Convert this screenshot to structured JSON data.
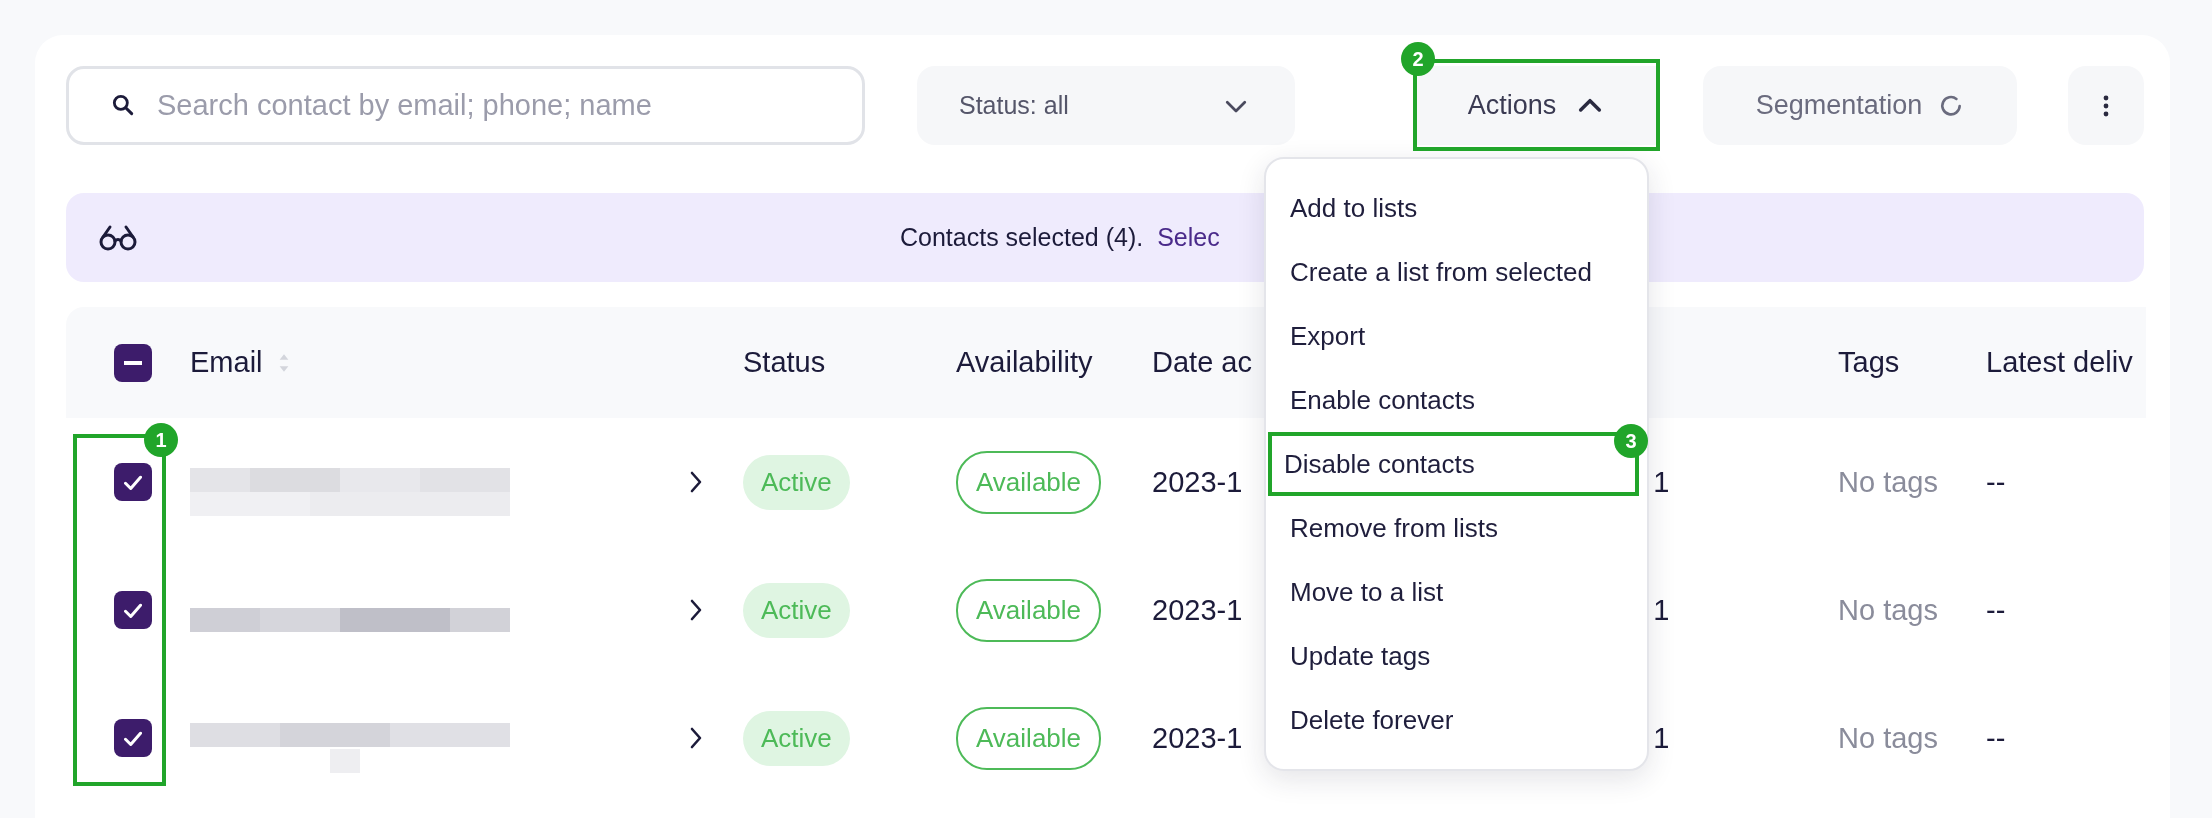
{
  "search": {
    "placeholder": "Search contact by email; phone; name"
  },
  "toolbar": {
    "status_filter": {
      "label": "Status: all",
      "expanded": false
    },
    "actions": {
      "label": "Actions",
      "expanded": true
    },
    "segmentation": {
      "label": "Segmentation"
    }
  },
  "selection_banner": {
    "text": "Contacts selected (4).",
    "link": "Selec"
  },
  "table": {
    "header_checkbox": {
      "indeterminate": true
    },
    "columns": [
      "Email",
      "Status",
      "Availability",
      "Date ac",
      "Tags",
      "Latest deliv"
    ],
    "rows": [
      {
        "selected": true,
        "status": "Active",
        "availability": "Available",
        "date_added": "2023-1",
        "column_6": "1",
        "tags": "No tags",
        "latest_delivery": "--"
      },
      {
        "selected": true,
        "status": "Active",
        "availability": "Available",
        "date_added": "2023-1",
        "column_6": "1",
        "tags": "No tags",
        "latest_delivery": "--"
      },
      {
        "selected": true,
        "status": "Active",
        "availability": "Available",
        "date_added": "2023-1",
        "column_6": "1",
        "tags": "No tags",
        "latest_delivery": "--"
      }
    ]
  },
  "actions_menu": {
    "items": [
      {
        "label": "Add to lists",
        "framed": false
      },
      {
        "label": "Create a list from selected",
        "framed": false
      },
      {
        "label": "Export",
        "framed": false
      },
      {
        "label": "Enable contacts",
        "framed": false
      },
      {
        "label": "Disable contacts",
        "framed": true
      },
      {
        "label": "Remove from lists",
        "framed": false
      },
      {
        "label": "Move to a list",
        "framed": false
      },
      {
        "label": "Update tags",
        "framed": false
      },
      {
        "label": "Delete forever",
        "framed": false
      }
    ]
  },
  "annotations": [
    {
      "label": "1",
      "kind": "row_checkboxes"
    },
    {
      "label": "2",
      "kind": "actions_button"
    },
    {
      "label": "3",
      "kind": "menu_item"
    }
  ]
}
